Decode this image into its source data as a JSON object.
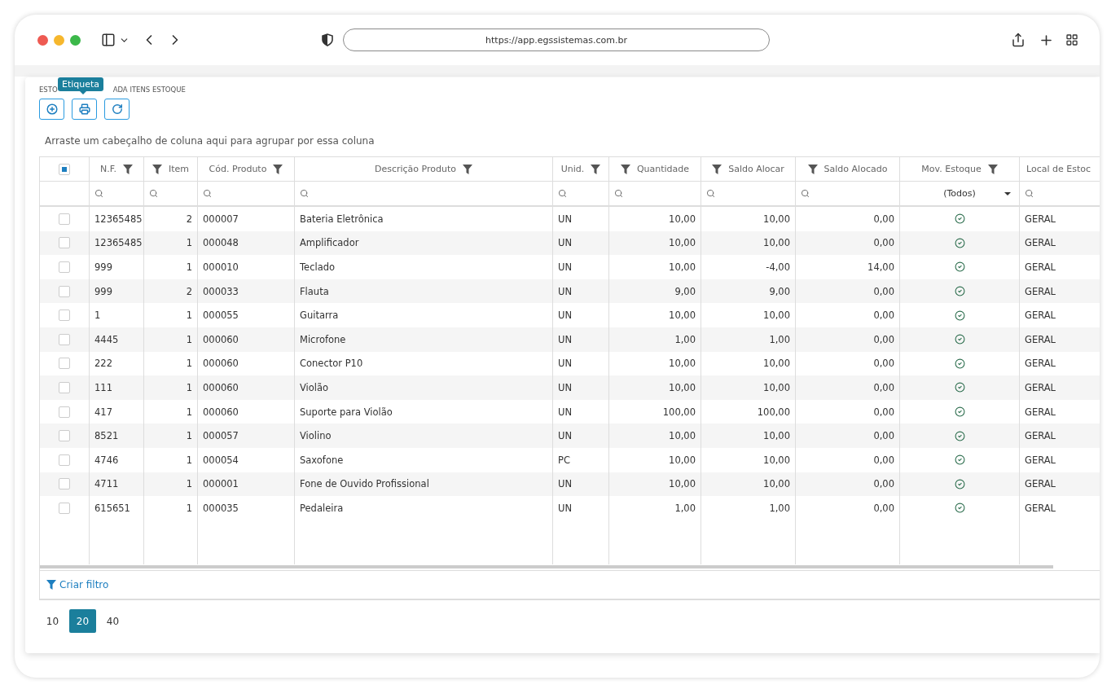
{
  "browser": {
    "url": "https://app.egssistemas.com.br"
  },
  "breadcrumb": [
    "ESTO",
    "ADA ITENS ESTOQUE"
  ],
  "tooltip": {
    "text": "Etiqueta"
  },
  "group_hint": "Arraste um cabeçalho de coluna aqui para agrupar por essa coluna",
  "table": {
    "select_all": {
      "indeterminate": true
    },
    "columns": [
      "N.F.",
      "Item",
      "Cód. Produto",
      "Descrição Produto",
      "Unid.",
      "Quantidade",
      "Saldo Alocar",
      "Saldo Alocado",
      "Mov. Estoque",
      "Local de Estoc"
    ],
    "filter_row": [
      {
        "kind": "search"
      },
      {
        "kind": "search"
      },
      {
        "kind": "search"
      },
      {
        "kind": "search"
      },
      {
        "kind": "search"
      },
      {
        "kind": "search"
      },
      {
        "kind": "search"
      },
      {
        "kind": "search"
      },
      {
        "kind": "dropdown",
        "value": "(Todos)"
      },
      {
        "kind": "search"
      }
    ],
    "rows": [
      {
        "selected": false,
        "cells": [
          "12365485",
          "2",
          "000007",
          "Bateria Eletrônica",
          "UN",
          "10,00",
          "10,00",
          "0,00",
          true,
          "GERAL"
        ]
      },
      {
        "selected": false,
        "cells": [
          "12365485",
          "1",
          "000048",
          "Amplificador",
          "UN",
          "10,00",
          "10,00",
          "0,00",
          true,
          "GERAL"
        ]
      },
      {
        "selected": false,
        "cells": [
          "999",
          "1",
          "000010",
          "Teclado",
          "UN",
          "10,00",
          "-4,00",
          "14,00",
          true,
          "GERAL"
        ]
      },
      {
        "selected": false,
        "cells": [
          "999",
          "2",
          "000033",
          "Flauta",
          "UN",
          "9,00",
          "9,00",
          "0,00",
          true,
          "GERAL"
        ]
      },
      {
        "selected": false,
        "cells": [
          "1",
          "1",
          "000055",
          "Guitarra",
          "UN",
          "10,00",
          "10,00",
          "0,00",
          true,
          "GERAL"
        ]
      },
      {
        "selected": false,
        "cells": [
          "4445",
          "1",
          "000060",
          "Microfone",
          "UN",
          "1,00",
          "1,00",
          "0,00",
          true,
          "GERAL"
        ]
      },
      {
        "selected": false,
        "cells": [
          "222",
          "1",
          "000060",
          "Conector P10",
          "UN",
          "10,00",
          "10,00",
          "0,00",
          true,
          "GERAL"
        ]
      },
      {
        "selected": false,
        "cells": [
          "111",
          "1",
          "000060",
          "Violão",
          "UN",
          "10,00",
          "10,00",
          "0,00",
          true,
          "GERAL"
        ]
      },
      {
        "selected": false,
        "cells": [
          "417",
          "1",
          "000060",
          "Suporte para Violão",
          "UN",
          "100,00",
          "100,00",
          "0,00",
          true,
          "GERAL"
        ]
      },
      {
        "selected": false,
        "cells": [
          "8521",
          "1",
          "000057",
          "Violino",
          "UN",
          "10,00",
          "10,00",
          "0,00",
          true,
          "GERAL"
        ]
      },
      {
        "selected": false,
        "cells": [
          "4746",
          "1",
          "000054",
          "Saxofone",
          "PC",
          "10,00",
          "10,00",
          "0,00",
          true,
          "GERAL"
        ]
      },
      {
        "selected": false,
        "cells": [
          "4711",
          "1",
          "000001",
          "Fone de Ouvido Profissional",
          "UN",
          "10,00",
          "10,00",
          "0,00",
          true,
          "GERAL"
        ]
      },
      {
        "selected": false,
        "cells": [
          "615651",
          "1",
          "000035",
          "Pedaleira",
          "UN",
          "1,00",
          "1,00",
          "0,00",
          true,
          "GERAL"
        ]
      }
    ]
  },
  "filter_builder": {
    "label": "Criar filtro"
  },
  "page_sizes": [
    {
      "label": "10",
      "selected": false
    },
    {
      "label": "20",
      "selected": true
    },
    {
      "label": "40",
      "selected": false
    }
  ]
}
